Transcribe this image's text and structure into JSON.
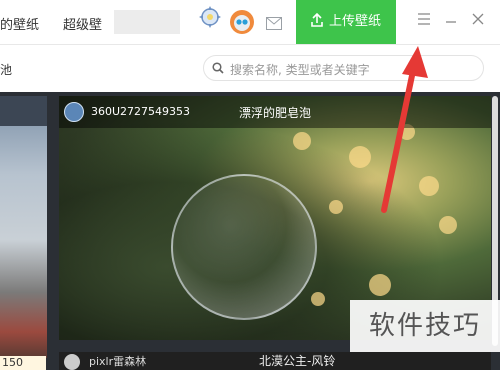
{
  "header": {
    "nav_partial": "的壁纸",
    "nav_super": "超级壁",
    "upload_label": "上传壁纸"
  },
  "subbar": {
    "left_text": "池",
    "search_placeholder": "搜索名称, 类型或者关键字"
  },
  "cards": [
    {
      "user": "360U2727549353",
      "title": "漂浮的肥皂泡"
    },
    {
      "user": "pixlr雷森林",
      "title": "北漠公主-风铃"
    }
  ],
  "left_card": {
    "badge": "150"
  },
  "watermark": "软件技巧",
  "colors": {
    "accent": "#3ec44b",
    "arrow": "#e53935"
  }
}
